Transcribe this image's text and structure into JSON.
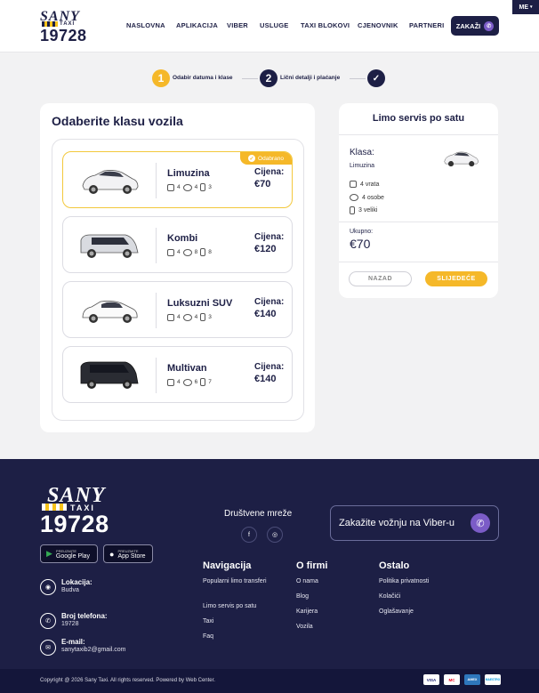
{
  "language": "ME",
  "header": {
    "logo_brand": "SANY",
    "logo_taxi": "TAXI",
    "logo_number": "19728",
    "nav": [
      "NASLOVNA",
      "APLIKACIJA",
      "VIBER",
      "USLUGE",
      "TAXI BLOKOVI",
      "CJENOVNIK",
      "PARTNERI"
    ],
    "order_label": "ZAKAŽI"
  },
  "steps": [
    {
      "number": "1",
      "label": "Odabir datuma i klase",
      "state": "active"
    },
    {
      "number": "2",
      "label": "Lični detalji i plaćanje",
      "state": "pending"
    },
    {
      "number": "✓",
      "label": "",
      "state": "final"
    }
  ],
  "vehicle_panel": {
    "title": "Odaberite klasu vozila",
    "selected_badge": "Odabrano",
    "price_label": "Cijena:",
    "vehicles": [
      {
        "name": "Limuzina",
        "doors": "4",
        "persons": "4",
        "bags": "3",
        "price": "€70",
        "selected": true
      },
      {
        "name": "Kombi",
        "doors": "4",
        "persons": "8",
        "bags": "8",
        "price": "€120",
        "selected": false
      },
      {
        "name": "Luksuzni SUV",
        "doors": "4",
        "persons": "4",
        "bags": "3",
        "price": "€140",
        "selected": false
      },
      {
        "name": "Multivan",
        "doors": "4",
        "persons": "6",
        "bags": "7",
        "price": "€140",
        "selected": false
      }
    ]
  },
  "summary": {
    "title": "Limo servis po satu",
    "class_label": "Klasa:",
    "class_value": "Limuzina",
    "doors": "4 vrata",
    "persons": "4 osobe",
    "bags": "3 veliki",
    "total_label": "Ukupno:",
    "total_value": "€70",
    "back_label": "NAZAD",
    "next_label": "SLIJEDEĆE"
  },
  "footer": {
    "logo_brand": "SANY",
    "logo_taxi": "TAXI",
    "logo_number": "19728",
    "google_small": "PREUZMITE",
    "google_big": "Google Play",
    "apple_small": "PREUZMITE",
    "apple_big": "App Store",
    "location_label": "Lokacija:",
    "location_value": "Budva",
    "phone_label": "Broj telefona:",
    "phone_value": "19728",
    "email_label": "E-mail:",
    "email_value": "sanytaxib2@gmail.com",
    "social_title": "Društvene mreže",
    "viber_cta": "Zakažite vožnju na Viber-u",
    "nav_title": "Navigacija",
    "nav_links": [
      "Popularni limo transferi",
      "Limo servis po satu",
      "Taxi",
      "Faq"
    ],
    "about_title": "O firmi",
    "about_links": [
      "O nama",
      "Blog",
      "Karijera",
      "Vozila"
    ],
    "other_title": "Ostalo",
    "other_links": [
      "Politika privatnosti",
      "Kolačići",
      "Oglašavanje"
    ],
    "copyright": "Copyright @ 2026 Sany Taxi. All rights reserved. Powered by Web Center.",
    "payments": [
      "VISA",
      "MC",
      "AMEX",
      "MAESTRO"
    ]
  },
  "colors": {
    "navy": "#1d1f45",
    "accent": "#f5b829",
    "viber": "#7b5cc7"
  }
}
